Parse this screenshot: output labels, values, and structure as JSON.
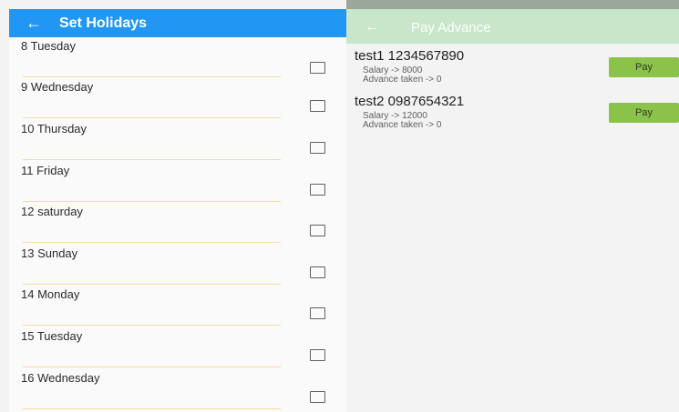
{
  "holidays": {
    "title": "Set Holidays",
    "back_icon": "arrow-left-icon",
    "days": [
      {
        "label": "8 Tuesday"
      },
      {
        "label": "9 Wednesday"
      },
      {
        "label": "10 Thursday"
      },
      {
        "label": "11 Friday"
      },
      {
        "label": "12 saturday"
      },
      {
        "label": "13 Sunday"
      },
      {
        "label": "14 Monday"
      },
      {
        "label": "15 Tuesday"
      },
      {
        "label": "16 Wednesday"
      }
    ]
  },
  "advance": {
    "title": "Pay Advance",
    "back_icon": "arrow-left-icon",
    "employees": [
      {
        "name": "test1 1234567890",
        "salary": "Salary -> 8000",
        "advance": "Advance taken -> 0",
        "pay_label": "Pay"
      },
      {
        "name": "test2 0987654321",
        "salary": "Salary -> 12000",
        "advance": "Advance taken -> 0",
        "pay_label": "Pay"
      }
    ]
  },
  "colors": {
    "holidays_appbar": "#2196f3",
    "advance_appbar": "#c8e6c9",
    "pay_button": "#8bc34a",
    "divider": "#f3dda0"
  }
}
